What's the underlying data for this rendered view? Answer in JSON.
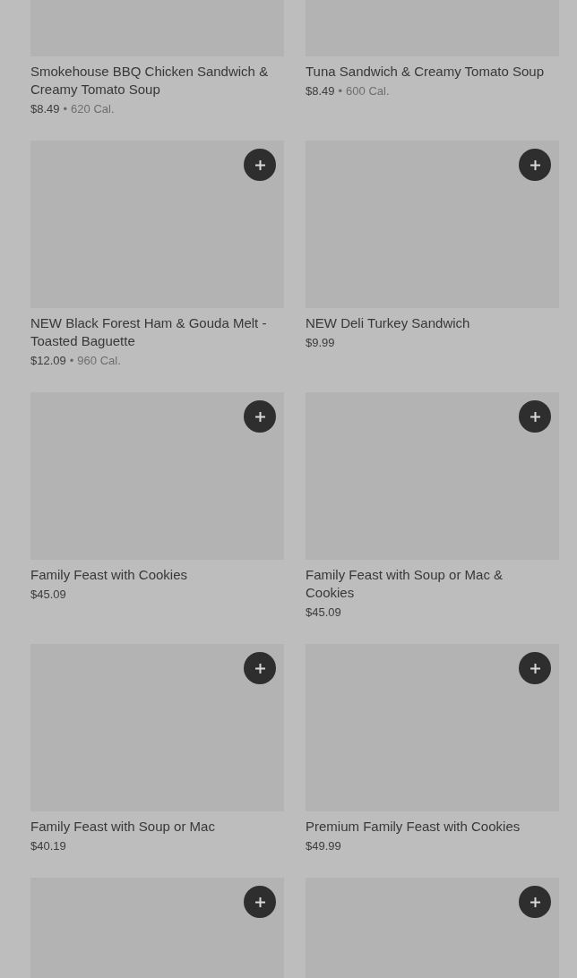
{
  "items": [
    {
      "kind": "item",
      "title": "Smokehouse BBQ Chicken Sandwich & Creamy Tomato Soup",
      "price": "$8.49",
      "separator": "•",
      "calories": "620 Cal."
    },
    {
      "kind": "item",
      "title": "Tuna Sandwich & Creamy Tomato Soup",
      "price": "$8.49",
      "separator": "•",
      "calories": "600 Cal."
    },
    {
      "kind": "item",
      "title": "NEW Black Forest Ham & Gouda Melt - Toasted Baguette",
      "price": "$12.09",
      "separator": "•",
      "calories": "960 Cal."
    },
    {
      "kind": "item",
      "title": "NEW Deli Turkey Sandwich",
      "price": "$9.99"
    },
    {
      "kind": "item",
      "title": "Family Feast with Cookies",
      "price": "$45.09"
    },
    {
      "kind": "item",
      "title": "Family Feast with Soup or Mac & Cookies",
      "price": "$45.09"
    },
    {
      "kind": "item",
      "title": "Family Feast with Soup or Mac",
      "price": "$40.19"
    },
    {
      "kind": "item",
      "title": "Premium Family Feast with Cookies",
      "price": "$49.99"
    },
    {
      "kind": "image_only"
    },
    {
      "kind": "image_only"
    }
  ]
}
